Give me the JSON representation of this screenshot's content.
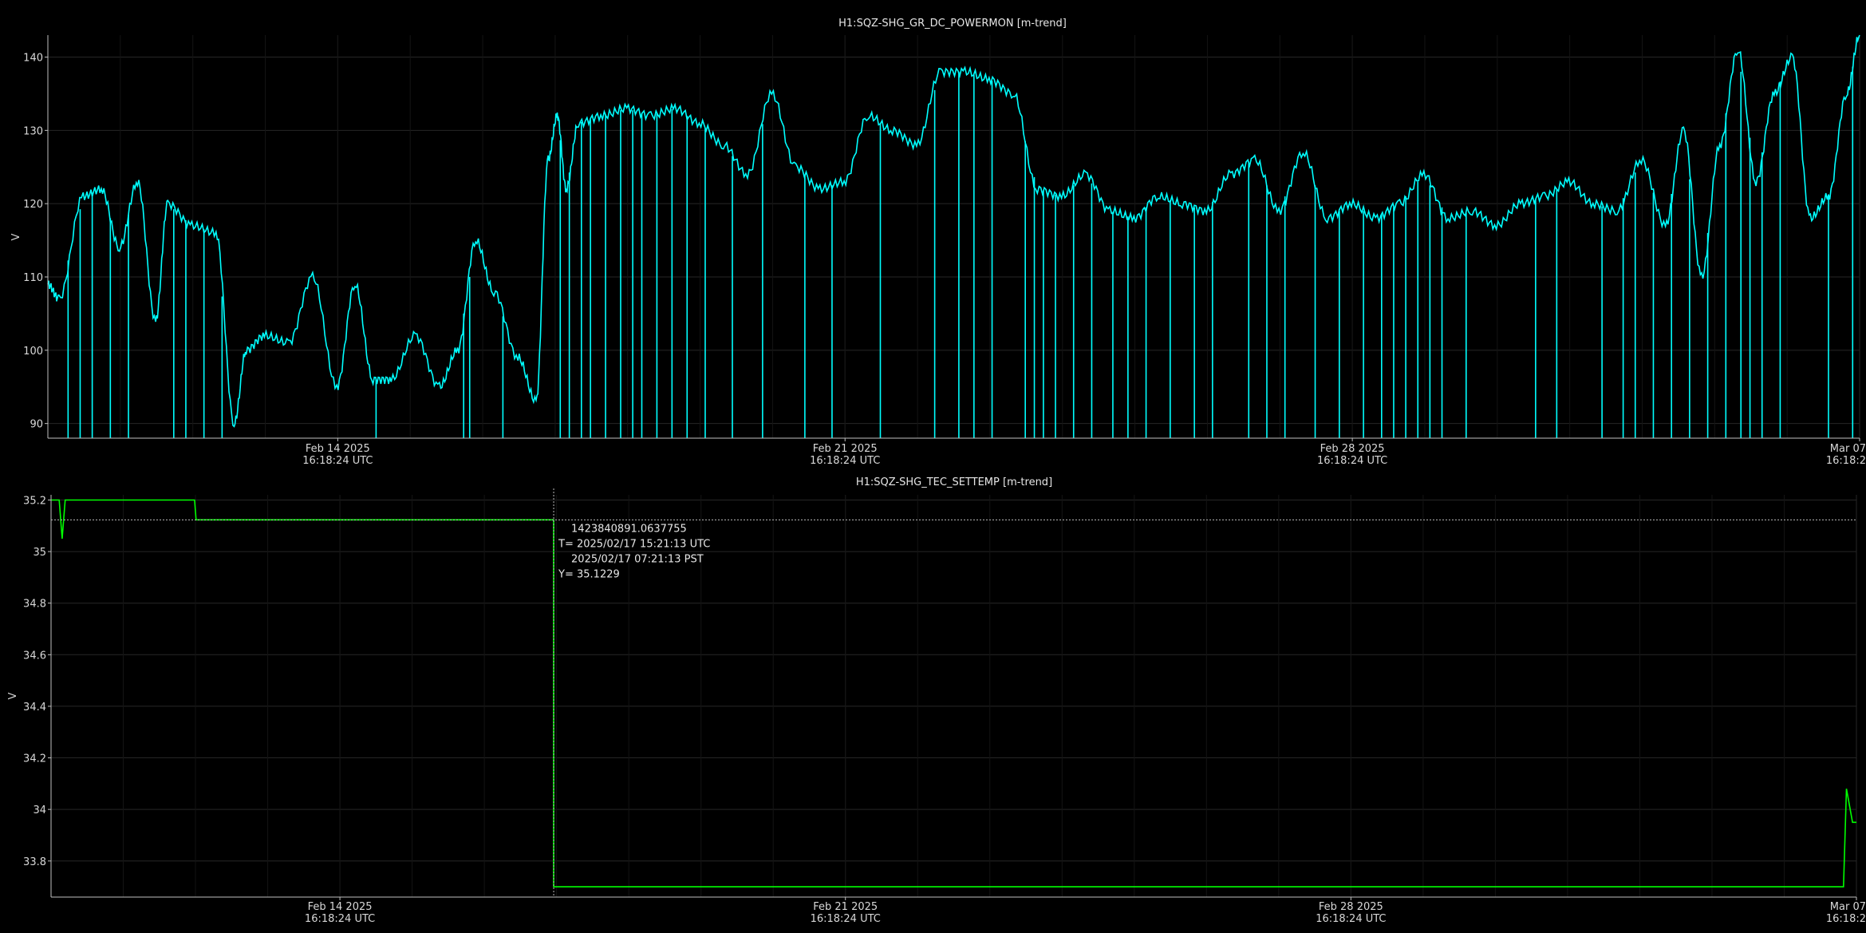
{
  "chart_data": [
    {
      "type": "line",
      "title": "H1:SQZ-SHG_GR_DC_POWERMON [m-trend]",
      "ylabel": "V",
      "ylim": [
        88,
        143
      ],
      "yticks": [
        90,
        100,
        110,
        120,
        130,
        140
      ],
      "xlim": [
        "2025-02-10T16:18:24Z",
        "2025-03-07T16:18:24Z"
      ],
      "xticks": [
        {
          "date": "2025-02-14T16:18:24Z",
          "line1": "Feb 14 2025",
          "line2": "16:18:24 UTC"
        },
        {
          "date": "2025-02-21T16:18:24Z",
          "line1": "Feb 21 2025",
          "line2": "16:18:24 UTC"
        },
        {
          "date": "2025-02-28T16:18:24Z",
          "line1": "Feb 28 2025",
          "line2": "16:18:24 UTC"
        },
        {
          "date": "2025-03-07T16:18:24Z",
          "line1": "Mar 07",
          "line2": "16:18:2"
        }
      ],
      "grid": true,
      "color": "#00ffff",
      "series": [
        {
          "x": [
            "2025-02-10T16:18:24Z",
            "2025-02-10T20:00:00Z",
            "2025-02-11T04:00:00Z",
            "2025-02-11T10:00:00Z",
            "2025-02-11T16:00:00Z",
            "2025-02-11T22:00:00Z",
            "2025-02-12T04:00:00Z",
            "2025-02-12T08:00:00Z",
            "2025-02-12T16:00:00Z",
            "2025-02-13T00:00:00Z",
            "2025-02-13T06:00:00Z",
            "2025-02-13T10:00:00Z",
            "2025-02-13T16:00:00Z",
            "2025-02-14T00:00:00Z",
            "2025-02-14T08:00:00Z",
            "2025-02-14T16:00:00Z",
            "2025-02-14T22:00:00Z",
            "2025-02-15T04:00:00Z",
            "2025-02-15T10:00:00Z",
            "2025-02-15T18:00:00Z",
            "2025-02-16T02:00:00Z",
            "2025-02-16T08:00:00Z",
            "2025-02-16T14:00:00Z",
            "2025-02-16T20:00:00Z",
            "2025-02-17T04:00:00Z",
            "2025-02-17T10:00:00Z",
            "2025-02-17T14:00:00Z",
            "2025-02-17T17:00:00Z",
            "2025-02-17T20:00:00Z",
            "2025-02-18T00:00:00Z",
            "2025-02-18T08:00:00Z",
            "2025-02-18T16:00:00Z",
            "2025-02-19T00:00:00Z",
            "2025-02-19T08:00:00Z",
            "2025-02-19T16:00:00Z",
            "2025-02-20T00:00:00Z",
            "2025-02-20T08:00:00Z",
            "2025-02-20T16:00:00Z",
            "2025-02-21T00:00:00Z",
            "2025-02-21T08:00:00Z",
            "2025-02-21T16:00:00Z",
            "2025-02-22T00:00:00Z",
            "2025-02-22T08:00:00Z",
            "2025-02-22T16:00:00Z",
            "2025-02-23T00:00:00Z",
            "2025-02-23T08:00:00Z",
            "2025-02-23T16:00:00Z",
            "2025-02-24T00:00:00Z",
            "2025-02-24T08:00:00Z",
            "2025-02-24T16:00:00Z",
            "2025-02-25T00:00:00Z",
            "2025-02-25T08:00:00Z",
            "2025-02-25T16:00:00Z",
            "2025-02-26T00:00:00Z",
            "2025-02-26T08:00:00Z",
            "2025-02-26T16:00:00Z",
            "2025-02-27T00:00:00Z",
            "2025-02-27T08:00:00Z",
            "2025-02-27T16:00:00Z",
            "2025-02-28T00:00:00Z",
            "2025-02-28T08:00:00Z",
            "2025-02-28T16:00:00Z",
            "2025-03-01T00:00:00Z",
            "2025-03-01T08:00:00Z",
            "2025-03-01T16:00:00Z",
            "2025-03-02T00:00:00Z",
            "2025-03-02T08:00:00Z",
            "2025-03-02T16:00:00Z",
            "2025-03-03T00:00:00Z",
            "2025-03-03T08:00:00Z",
            "2025-03-03T16:00:00Z",
            "2025-03-04T00:00:00Z",
            "2025-03-04T08:00:00Z",
            "2025-03-04T16:00:00Z",
            "2025-03-05T00:00:00Z",
            "2025-03-05T06:00:00Z",
            "2025-03-05T12:00:00Z",
            "2025-03-05T18:00:00Z",
            "2025-03-06T00:00:00Z",
            "2025-03-06T06:00:00Z",
            "2025-03-06T12:00:00Z",
            "2025-03-06T18:00:00Z",
            "2025-03-07T00:00:00Z",
            "2025-03-07T06:00:00Z",
            "2025-03-07T12:00:00Z",
            "2025-03-07T16:18:24Z"
          ],
          "values": [
            109,
            107,
            121,
            122,
            114,
            123,
            104,
            120,
            117,
            116,
            90,
            100,
            102,
            101,
            110,
            95,
            109,
            96,
            96,
            102,
            95,
            100,
            115,
            108,
            99,
            93,
            126,
            132,
            122,
            131,
            132,
            133,
            132,
            133,
            131,
            128,
            124,
            135,
            125,
            122,
            123,
            132,
            130,
            128,
            138,
            138,
            137,
            135,
            122,
            121,
            124,
            119,
            118,
            121,
            120,
            119,
            124,
            126,
            119,
            127,
            118,
            120,
            118,
            120,
            124,
            118,
            119,
            117,
            120,
            121,
            123,
            120,
            119,
            126,
            117,
            130,
            110,
            128,
            141,
            123,
            135,
            140,
            118,
            121,
            135,
            143
          ],
          "dropouts": [
            "2025-02-10T23:00:00Z",
            "2025-02-11T03:00:00Z",
            "2025-02-11T07:00:00Z",
            "2025-02-11T13:00:00Z",
            "2025-02-11T19:00:00Z",
            "2025-02-12T10:00:00Z",
            "2025-02-12T14:00:00Z",
            "2025-02-12T20:00:00Z",
            "2025-02-13T02:00:00Z",
            "2025-02-15T05:00:00Z",
            "2025-02-16T10:00:00Z",
            "2025-02-16T12:00:00Z",
            "2025-02-16T23:00:00Z",
            "2025-02-17T18:00:00Z",
            "2025-02-17T21:00:00Z",
            "2025-02-18T01:00:00Z",
            "2025-02-18T04:00:00Z",
            "2025-02-18T09:00:00Z",
            "2025-02-18T14:00:00Z",
            "2025-02-18T18:00:00Z",
            "2025-02-18T21:00:00Z",
            "2025-02-19T02:00:00Z",
            "2025-02-19T07:00:00Z",
            "2025-02-19T12:00:00Z",
            "2025-02-19T18:00:00Z",
            "2025-02-20T03:00:00Z",
            "2025-02-20T13:00:00Z",
            "2025-02-21T03:00:00Z",
            "2025-02-21T12:00:00Z",
            "2025-02-22T04:00:00Z",
            "2025-02-22T22:00:00Z",
            "2025-02-23T06:00:00Z",
            "2025-02-23T11:00:00Z",
            "2025-02-23T17:00:00Z",
            "2025-02-24T04:00:00Z",
            "2025-02-24T07:00:00Z",
            "2025-02-24T10:00:00Z",
            "2025-02-24T14:00:00Z",
            "2025-02-24T20:00:00Z",
            "2025-02-25T02:00:00Z",
            "2025-02-25T09:00:00Z",
            "2025-02-25T14:00:00Z",
            "2025-02-25T20:00:00Z",
            "2025-02-26T04:00:00Z",
            "2025-02-26T12:00:00Z",
            "2025-02-26T18:00:00Z",
            "2025-02-27T06:00:00Z",
            "2025-02-27T12:00:00Z",
            "2025-02-27T18:00:00Z",
            "2025-02-28T04:00:00Z",
            "2025-02-28T12:00:00Z",
            "2025-02-28T20:00:00Z",
            "2025-03-01T02:00:00Z",
            "2025-03-01T06:00:00Z",
            "2025-03-01T10:00:00Z",
            "2025-03-01T14:00:00Z",
            "2025-03-01T18:00:00Z",
            "2025-03-01T22:00:00Z",
            "2025-03-02T06:00:00Z",
            "2025-03-03T05:00:00Z",
            "2025-03-03T12:00:00Z",
            "2025-03-04T03:00:00Z",
            "2025-03-04T10:00:00Z",
            "2025-03-04T14:00:00Z",
            "2025-03-04T20:00:00Z",
            "2025-03-05T02:00:00Z",
            "2025-03-05T08:00:00Z",
            "2025-03-05T14:00:00Z",
            "2025-03-05T20:00:00Z",
            "2025-03-06T01:00:00Z",
            "2025-03-06T04:00:00Z",
            "2025-03-06T08:00:00Z",
            "2025-03-06T14:00:00Z",
            "2025-03-07T06:00:00Z",
            "2025-03-07T14:00:00Z"
          ]
        }
      ]
    },
    {
      "type": "line",
      "title": "H1:SQZ-SHG_TEC_SETTEMP [m-trend]",
      "ylabel": "V",
      "ylim": [
        33.66,
        35.22
      ],
      "yticks": [
        33.8,
        34,
        34.2,
        34.4,
        34.6,
        34.8,
        35,
        35.2
      ],
      "xlim": [
        "2025-02-10T16:18:24Z",
        "2025-03-07T16:18:24Z"
      ],
      "xticks": [
        {
          "date": "2025-02-14T16:18:24Z",
          "line1": "Feb 14 2025",
          "line2": "16:18:24 UTC"
        },
        {
          "date": "2025-02-21T16:18:24Z",
          "line1": "Feb 21 2025",
          "line2": "16:18:24 UTC"
        },
        {
          "date": "2025-02-28T16:18:24Z",
          "line1": "Feb 28 2025",
          "line2": "16:18:24 UTC"
        },
        {
          "date": "2025-03-07T16:18:24Z",
          "line1": "Mar 07",
          "line2": "16:18:2"
        }
      ],
      "grid": true,
      "color": "#00ff00",
      "series": [
        {
          "x": [
            "2025-02-10T16:18:24Z",
            "2025-02-10T19:00:00Z",
            "2025-02-10T20:00:00Z",
            "2025-02-10T21:00:00Z",
            "2025-02-12T16:00:00Z",
            "2025-02-12T16:30:00Z",
            "2025-02-17T15:21:13Z",
            "2025-02-17T15:21:14Z",
            "2025-03-07T12:00:00Z",
            "2025-03-07T13:00:00Z",
            "2025-03-07T15:00:00Z",
            "2025-03-07T16:18:24Z"
          ],
          "values": [
            35.2,
            35.2,
            35.05,
            35.2,
            35.2,
            35.123,
            35.123,
            33.7,
            33.7,
            34.08,
            33.95,
            33.95
          ]
        }
      ],
      "cursor": {
        "x": "2025-02-17T15:21:13Z",
        "y": 35.1229,
        "gps": "1423840891.0637755",
        "t_label": "T= 2025/02/17 15:21:13 UTC",
        "local_label": "2025/02/17 07:21:13 PST",
        "y_label": "Y= 35.1229"
      }
    }
  ]
}
